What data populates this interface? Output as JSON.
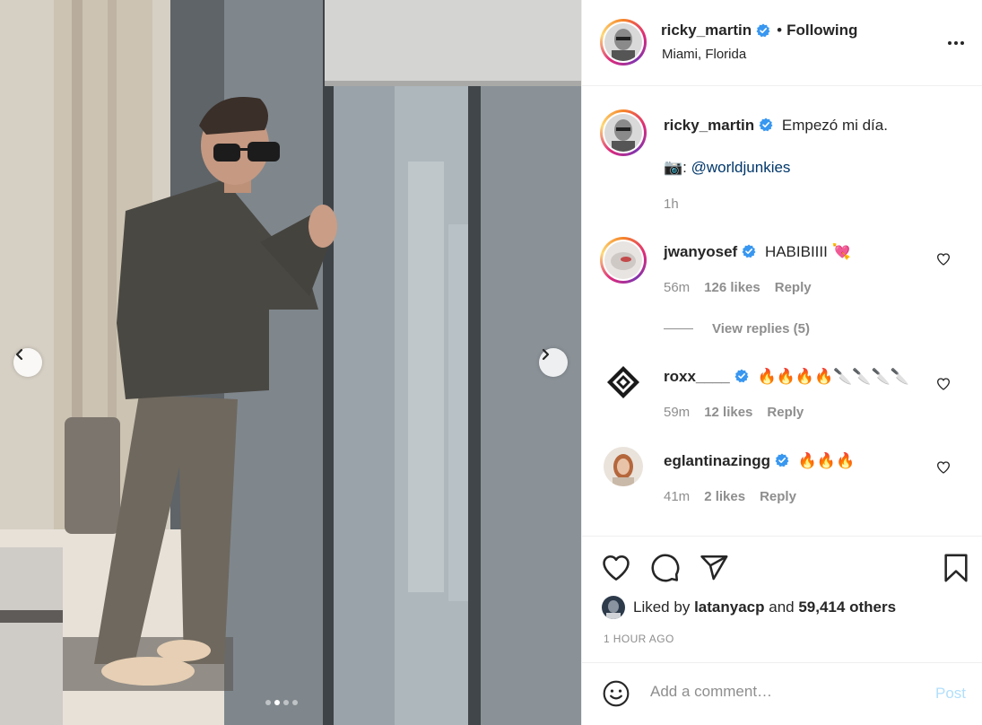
{
  "post": {
    "author": "ricky_martin",
    "follow_separator": "•",
    "follow_status": "Following",
    "location": "Miami, Florida",
    "caption_text": "Empezó mi día.",
    "caption_camera": "📷:",
    "caption_mention": "@worldjunkies",
    "caption_time": "1h"
  },
  "comments": [
    {
      "username": "jwanyosef",
      "text": "HABIBIIII 💘",
      "time": "56m",
      "likes": "126 likes",
      "reply": "Reply",
      "view_replies": "View replies (5)"
    },
    {
      "username": "roxx____",
      "text": "🔥🔥🔥🔥🔪🔪🔪🔪",
      "time": "59m",
      "likes": "12 likes",
      "reply": "Reply"
    },
    {
      "username": "eglantinazingg",
      "text": "🔥🔥🔥",
      "time": "41m",
      "likes": "2 likes",
      "reply": "Reply"
    }
  ],
  "likes": {
    "prefix": "Liked by",
    "user": "latanyacp",
    "conjunction": "and",
    "others": "59,414 others"
  },
  "timestamp": "1 HOUR AGO",
  "add_comment": {
    "placeholder": "Add a comment…",
    "post_label": "Post"
  },
  "carousel": {
    "count": 4,
    "active_index": 1
  },
  "colors": {
    "verified": "#3897f0",
    "mention": "#00376b",
    "post_disabled": "#b2dffc",
    "muted": "#8e8e8e"
  },
  "icons": [
    "chevron-left-icon",
    "chevron-right-icon",
    "more-icon",
    "verified-icon",
    "heart-icon",
    "comment-icon",
    "share-icon",
    "bookmark-icon",
    "emoji-icon"
  ]
}
